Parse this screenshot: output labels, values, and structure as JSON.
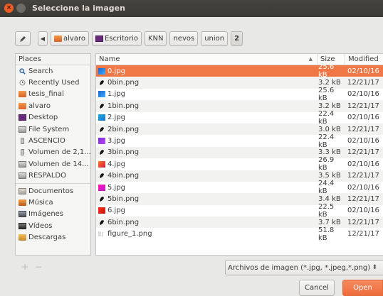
{
  "window": {
    "title": "Seleccione la imagen",
    "close_glyph": "×"
  },
  "pathbar": {
    "edit_icon": "pencil-icon",
    "back_glyph": "◀",
    "crumbs": [
      {
        "label": "alvaro",
        "icon": "home-folder-icon"
      },
      {
        "label": "Escritorio",
        "icon": "desktop-icon"
      },
      {
        "label": "KNN"
      },
      {
        "label": "nevos"
      },
      {
        "label": "union"
      },
      {
        "label": "2",
        "current": true
      }
    ]
  },
  "places": {
    "header": "Places",
    "items": [
      {
        "label": "Search",
        "icon": "search-icon"
      },
      {
        "label": "Recently Used",
        "icon": "clock-icon"
      },
      {
        "label": "tesis_final",
        "icon": "folder-icon"
      },
      {
        "label": "alvaro",
        "icon": "home-folder-icon"
      },
      {
        "label": "Desktop",
        "icon": "desktop-icon"
      },
      {
        "label": "File System",
        "icon": "drive-icon"
      },
      {
        "label": "ASCENCIO",
        "icon": "usb-icon"
      },
      {
        "label": "Volumen de 2,1...",
        "icon": "usb-icon"
      },
      {
        "label": "Volumen de 14...",
        "icon": "drive-icon"
      },
      {
        "label": "RESPALDO",
        "icon": "drive-icon"
      },
      {
        "label": "Documentos",
        "icon": "documents-folder-icon"
      },
      {
        "label": "Música",
        "icon": "music-folder-icon"
      },
      {
        "label": "Imágenes",
        "icon": "pictures-folder-icon"
      },
      {
        "label": "Vídeos",
        "icon": "videos-folder-icon"
      },
      {
        "label": "Descargas",
        "icon": "downloads-folder-icon"
      }
    ],
    "add_glyph": "+",
    "remove_glyph": "−"
  },
  "files": {
    "columns": {
      "name": "Name",
      "size": "Size",
      "modified": "Modified"
    },
    "sort_glyph": "▲",
    "rows": [
      {
        "name": "0.jpg",
        "size": "25.6 kB",
        "modified": "02/10/16",
        "icon": "image-thumb-blue",
        "selected": true
      },
      {
        "name": "0bin.png",
        "size": "3.2 kB",
        "modified": "12/21/17",
        "icon": "image-thumb-mask"
      },
      {
        "name": "1.jpg",
        "size": "25.6 kB",
        "modified": "02/10/16",
        "icon": "image-thumb-blue"
      },
      {
        "name": "1bin.png",
        "size": "3.2 kB",
        "modified": "12/21/17",
        "icon": "image-thumb-mask"
      },
      {
        "name": "2.jpg",
        "size": "22.4 kB",
        "modified": "02/10/16",
        "icon": "image-thumb-cyan"
      },
      {
        "name": "2bin.png",
        "size": "3.0 kB",
        "modified": "12/21/17",
        "icon": "image-thumb-mask"
      },
      {
        "name": "3.jpg",
        "size": "22.4 kB",
        "modified": "02/10/16",
        "icon": "image-thumb-purple"
      },
      {
        "name": "3bin.png",
        "size": "3.3 kB",
        "modified": "12/21/17",
        "icon": "image-thumb-mask"
      },
      {
        "name": "4.jpg",
        "size": "26.9 kB",
        "modified": "02/10/16",
        "icon": "image-thumb-orange"
      },
      {
        "name": "4bin.png",
        "size": "3.5 kB",
        "modified": "12/21/17",
        "icon": "image-thumb-mask"
      },
      {
        "name": "5.jpg",
        "size": "24.4 kB",
        "modified": "02/10/16",
        "icon": "image-thumb-magenta"
      },
      {
        "name": "5bin.png",
        "size": "3.4 kB",
        "modified": "12/21/17",
        "icon": "image-thumb-mask"
      },
      {
        "name": "6.jpg",
        "size": "22.5 kB",
        "modified": "02/10/16",
        "icon": "image-thumb-red"
      },
      {
        "name": "6bin.png",
        "size": "3.7 kB",
        "modified": "12/21/17",
        "icon": "image-thumb-mask"
      },
      {
        "name": "figure_1.png",
        "size": "51.8 kB",
        "modified": "12/21/17",
        "icon": "image-thumb-figure"
      }
    ]
  },
  "filter": {
    "value": "Archivos de imagen (*.jpg, *.jpeg,*.png)",
    "spin_glyph": "⬍"
  },
  "buttons": {
    "cancel": "Cancel",
    "open": "Open"
  },
  "colors": {
    "selection": "#f07746",
    "open_button": "#ef7243",
    "titlebar": "#3d3c38",
    "close_button": "#f15d22"
  }
}
